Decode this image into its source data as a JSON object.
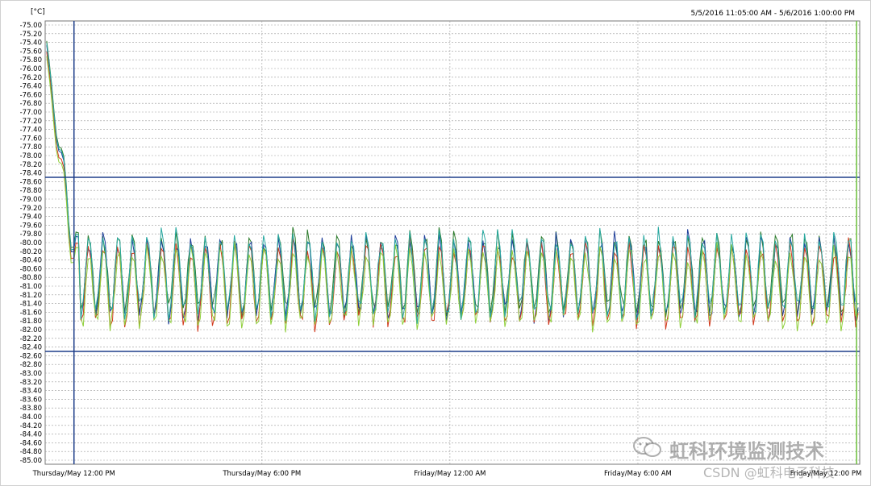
{
  "chart_data": {
    "type": "line",
    "unit_label": "[°C]",
    "time_range": "5/5/2016 11:05:00 AM - 5/6/2016 1:00:00 PM",
    "ylim": [
      -85.0,
      -75.0
    ],
    "y_tick_step": 0.2,
    "x_ticks": [
      "Thursday/May 12:00 PM",
      "Thursday/May 6:00 PM",
      "Friday/May 12:00 AM",
      "Friday/May 6:00 AM",
      "Friday/May 12:00 PM"
    ],
    "x_range_hours": [
      0,
      26
    ],
    "reference_lines_y": [
      -78.5,
      -82.5
    ],
    "cursor_lines_hours": [
      0.92,
      25.9
    ],
    "series_colors": [
      "#2a7a2a",
      "#1f3f9a",
      "#d23a1e",
      "#8fcf3a",
      "#28a8a0"
    ],
    "series_offsets": [
      0.1,
      0.0,
      -0.15,
      -0.25,
      0.05
    ],
    "steady_center": -80.8,
    "steady_amplitude": 1.1,
    "cycle_minutes": 28,
    "settle_start_value": -75.0,
    "settle_hours": 1.1
  },
  "watermark": {
    "text": "虹科环境监测技术",
    "credit": "CSDN @虹科电子科技",
    "icon": "wechat-icon"
  }
}
